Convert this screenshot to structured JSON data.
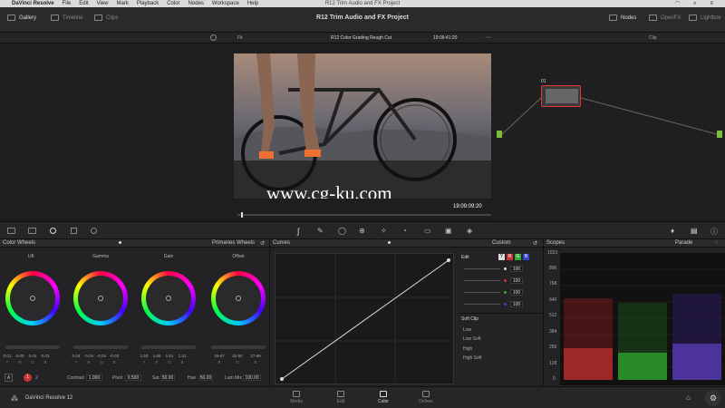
{
  "mac_menu": {
    "app": "DaVinci Resolve",
    "items": [
      "File",
      "Edit",
      "View",
      "Mark",
      "Playback",
      "Color",
      "Nodes",
      "Workspace",
      "Help"
    ],
    "window_title": "R12 Trim Audio and FX Project"
  },
  "top": {
    "tabs": [
      {
        "label": "Gallery"
      },
      {
        "label": "Timeline"
      },
      {
        "label": "Clips"
      }
    ],
    "project_title": "R12 Trim Audio and FX Project",
    "right_tabs": [
      {
        "label": "Nodes"
      },
      {
        "label": "OpenFX"
      },
      {
        "label": "Lightbox"
      }
    ]
  },
  "viewer": {
    "fit": "Fit",
    "clip_name": "R12 Color Grading Rough Cut",
    "timecode": "19:09:41:20",
    "overlay_timecode": "19:09:09:20",
    "clip_dropdown": "Clip",
    "watermark": "www.cg-ku.com"
  },
  "node": {
    "id": "01"
  },
  "color_wheels": {
    "title": "Color Wheels",
    "mode": "Primaries Wheels",
    "wheels": [
      {
        "label": "Lift",
        "values": [
          "0.01",
          "0.00",
          "0.01",
          "0.03"
        ]
      },
      {
        "label": "Gamma",
        "values": [
          "0.04",
          "-0.04",
          "-0.04",
          "-0.03"
        ]
      },
      {
        "label": "Gain",
        "values": [
          "1.53",
          "1.66",
          "1.51",
          "1.41"
        ]
      },
      {
        "label": "Offset",
        "values": [
          "19.87",
          "22.94",
          "27.89",
          ""
        ]
      }
    ],
    "channel_labels": [
      "Y",
      "R",
      "G",
      "B"
    ],
    "page_a": "A",
    "page_1": "1",
    "page_2": "2",
    "contrast_label": "Contrast",
    "contrast": "1.000",
    "pivot_label": "Pivot",
    "pivot": "0.500",
    "sat_label": "Sat",
    "sat": "50.00",
    "hue_label": "Hue",
    "hue": "50.00",
    "lummix_label": "Lum Mix",
    "lummix": "100.00"
  },
  "curves": {
    "title": "Curves",
    "mode": "Custom",
    "edit_label": "Edit",
    "channels": [
      "Y",
      "R",
      "G",
      "B"
    ],
    "values": [
      "100",
      "100",
      "100",
      "100"
    ],
    "soft_clip": "Soft Clip",
    "soft_labels": [
      "Low",
      "Low Soft",
      "High",
      "High Soft"
    ]
  },
  "scopes": {
    "title": "Scopes",
    "mode": "Parade",
    "scale": [
      "1023",
      "896",
      "768",
      "640",
      "512",
      "384",
      "256",
      "128",
      "0"
    ]
  },
  "bottom": {
    "app": "DaVinci Resolve 12",
    "pages": [
      {
        "label": "Media"
      },
      {
        "label": "Edit"
      },
      {
        "label": "Color"
      },
      {
        "label": "Deliver"
      }
    ]
  },
  "colors": {
    "accent": "#e33",
    "node_green": "#7dbb3a",
    "bg": "#1e1e20"
  }
}
